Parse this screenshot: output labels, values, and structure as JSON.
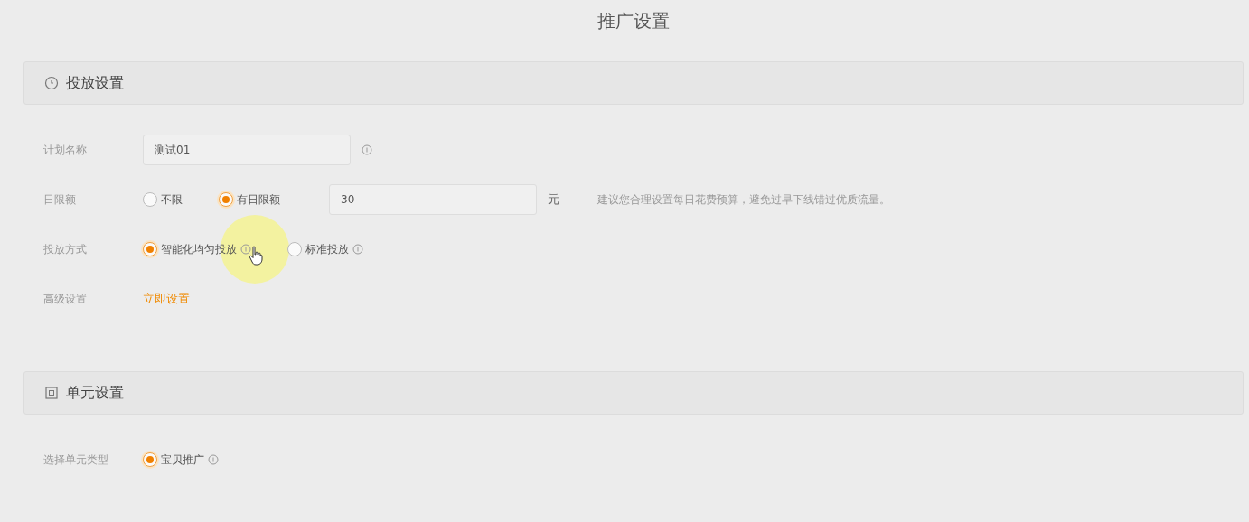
{
  "page_title": "推广设置",
  "sections": [
    {
      "title": "投放设置",
      "rows": [
        {
          "kind": "text",
          "label": "计划名称",
          "value": "测试01",
          "help": true
        },
        {
          "kind": "budget",
          "label": "日限额",
          "options": [
            {
              "label": "不限",
              "selected": false
            },
            {
              "label": "有日限额",
              "selected": true
            }
          ],
          "value": "30",
          "unit": "元",
          "hint": "建议您合理设置每日花费预算，避免过早下线错过优质流量。"
        },
        {
          "kind": "radio",
          "label": "投放方式",
          "options": [
            {
              "label": "智能化均匀投放",
              "selected": true,
              "help": true,
              "cursor": true
            },
            {
              "label": "标准投放",
              "selected": false,
              "help": true
            }
          ]
        },
        {
          "kind": "link",
          "label": "高级设置",
          "link": "立即设置"
        }
      ]
    },
    {
      "title": "单元设置",
      "rows": [
        {
          "kind": "radio",
          "label": "选择单元类型",
          "options": [
            {
              "label": "宝贝推广",
              "selected": true,
              "help": true
            }
          ]
        }
      ]
    }
  ]
}
